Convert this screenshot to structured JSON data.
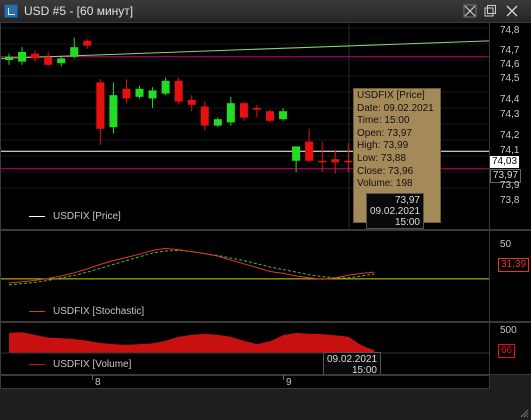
{
  "window": {
    "title": "USD #5 - [60 минут]",
    "controls": {
      "crosshair": "crosshair-icon",
      "restore": "restore-icon",
      "close": "close-icon"
    }
  },
  "colors": {
    "background": "#000000",
    "candle_up": "#22dd22",
    "candle_down": "#e81010",
    "ma_line": "#8ed87a",
    "level_magenta": "#c8007a",
    "level_white": "#ffffff",
    "stoch_main": "#e83030",
    "stoch_signal": "#3cbf3c",
    "stoch_level": "#cfcf00",
    "volume": "#c81010",
    "tooltip_bg": "#a48a59"
  },
  "price_panel": {
    "axis_labels": [
      "74,8",
      "74,7",
      "74,6",
      "74,5",
      "74,4",
      "74,3",
      "74,2",
      "74,1",
      "73,9",
      "73,8"
    ],
    "current_price_label": "74,03",
    "cursor_price_label": "73,97",
    "legend": "USDFIX [Price]",
    "tooltip": {
      "title": "USDFIX [Price]",
      "date": "Date: 09.02.2021",
      "time": "Time: 15:00",
      "open": "Open:  73,97",
      "high": "High:  73,99",
      "low": "Low:  73,88",
      "close": "Close: 73,96",
      "volume": "Volume: 198"
    },
    "cursor_box": {
      "price": "73,97",
      "date": "09.02.2021",
      "time": "15:00"
    }
  },
  "stochastic_panel": {
    "axis_label": "50",
    "value_label": "31,39",
    "legend": "USDFIX [Stochastic]"
  },
  "volume_panel": {
    "axis_label": "500",
    "value_label": "66",
    "legend": "USDFIX [Volume]",
    "cursor_box": {
      "date": "09.02.2021",
      "time": "15:00"
    }
  },
  "date_axis": {
    "ticks": [
      "8",
      "9"
    ]
  },
  "chart_data": {
    "type": "candlestick",
    "price_range": [
      73.8,
      74.8
    ],
    "candles": [
      {
        "o": 74.6,
        "h": 74.64,
        "l": 74.57,
        "c": 74.62
      },
      {
        "o": 74.59,
        "h": 74.68,
        "l": 74.57,
        "c": 74.65
      },
      {
        "o": 74.64,
        "h": 74.66,
        "l": 74.59,
        "c": 74.61
      },
      {
        "o": 74.62,
        "h": 74.65,
        "l": 74.56,
        "c": 74.57
      },
      {
        "o": 74.58,
        "h": 74.62,
        "l": 74.56,
        "c": 74.61
      },
      {
        "o": 74.62,
        "h": 74.74,
        "l": 74.61,
        "c": 74.68
      },
      {
        "o": 74.72,
        "h": 74.73,
        "l": 74.67,
        "c": 74.69
      },
      {
        "o": 74.46,
        "h": 74.48,
        "l": 74.07,
        "c": 74.17
      },
      {
        "o": 74.18,
        "h": 74.46,
        "l": 74.14,
        "c": 74.38
      },
      {
        "o": 74.42,
        "h": 74.48,
        "l": 74.33,
        "c": 74.36
      },
      {
        "o": 74.37,
        "h": 74.44,
        "l": 74.36,
        "c": 74.42
      },
      {
        "o": 74.36,
        "h": 74.43,
        "l": 74.3,
        "c": 74.41
      },
      {
        "o": 74.39,
        "h": 74.49,
        "l": 74.38,
        "c": 74.47
      },
      {
        "o": 74.47,
        "h": 74.49,
        "l": 74.32,
        "c": 74.34
      },
      {
        "o": 74.35,
        "h": 74.38,
        "l": 74.28,
        "c": 74.32
      },
      {
        "o": 74.31,
        "h": 74.34,
        "l": 74.16,
        "c": 74.19
      },
      {
        "o": 74.19,
        "h": 74.24,
        "l": 74.18,
        "c": 74.23
      },
      {
        "o": 74.21,
        "h": 74.37,
        "l": 74.19,
        "c": 74.33
      },
      {
        "o": 74.33,
        "h": 74.34,
        "l": 74.22,
        "c": 74.24
      },
      {
        "o": 74.3,
        "h": 74.32,
        "l": 74.24,
        "c": 74.29
      },
      {
        "o": 74.28,
        "h": 74.29,
        "l": 74.21,
        "c": 74.22
      },
      {
        "o": 74.23,
        "h": 74.3,
        "l": 74.22,
        "c": 74.28
      },
      {
        "o": 73.97,
        "h": 74.0,
        "l": 73.9,
        "c": 74.06
      },
      {
        "o": 74.09,
        "h": 74.17,
        "l": 73.96,
        "c": 73.97
      },
      {
        "o": 73.97,
        "h": 74.09,
        "l": 73.9,
        "c": 73.96
      },
      {
        "o": 73.98,
        "h": 74.04,
        "l": 73.89,
        "c": 73.96
      },
      {
        "o": 73.97,
        "h": 74.08,
        "l": 73.9,
        "c": 73.96
      },
      {
        "o": 73.97,
        "h": 73.99,
        "l": 73.88,
        "c": 73.96
      },
      {
        "o": 73.93,
        "h": 73.97,
        "l": 73.92,
        "c": 73.96
      }
    ],
    "ma_line": {
      "start": 74.61,
      "end": 74.72
    },
    "levels": [
      74.62,
      74.03,
      73.92
    ],
    "stochastic": {
      "range": [
        0,
        100
      ],
      "level": 31.39,
      "main": [
        25,
        27,
        29,
        32,
        36,
        41,
        47,
        54,
        60,
        65,
        70,
        76,
        79,
        77,
        74,
        71,
        67,
        61,
        55,
        49,
        43,
        40,
        36,
        33,
        31,
        33,
        37,
        40,
        42
      ],
      "signal": [
        22,
        24,
        26,
        29,
        33,
        37,
        42,
        48,
        54,
        60,
        66,
        72,
        75,
        76,
        74,
        71,
        68,
        64,
        60,
        55,
        50,
        46,
        42,
        38,
        35,
        33,
        33,
        36,
        39
      ]
    },
    "volume": {
      "range": [
        0,
        700
      ],
      "values": [
        520,
        540,
        470,
        400,
        380,
        360,
        320,
        260,
        230,
        210,
        230,
        250,
        320,
        420,
        470,
        500,
        470,
        420,
        320,
        230,
        300,
        460,
        520,
        500,
        490,
        460,
        420,
        200,
        66
      ]
    }
  }
}
